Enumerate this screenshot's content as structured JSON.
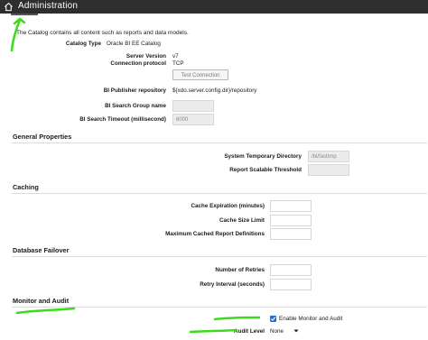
{
  "header": {
    "title": "Administration",
    "home_icon": "home-icon"
  },
  "catalog": {
    "description": "The Catalog contains all content such as reports and data models.",
    "type_label": "Catalog Type",
    "type_value": "Oracle BI EE Catalog",
    "server_version_label": "Server Version",
    "server_version_value": "v7",
    "connection_protocol_label": "Connection protocol",
    "connection_protocol_value": "TCP",
    "test_connection_label": "Test Connection",
    "bi_publisher_repository_label": "BI Publisher repository",
    "bi_publisher_repository_value": "${xdo.server.config.dir}/repository",
    "bi_search_group_label": "BI Search Group name",
    "bi_search_group_value": "",
    "bi_search_timeout_label": "BI Search Timeout (millisecond)",
    "bi_search_timeout_value": "6000"
  },
  "general": {
    "title": "General Properties",
    "system_temp_dir_label": "System Temporary Directory",
    "system_temp_dir_value": "/bi/fasttmp",
    "report_scalable_threshold_label": "Report Scalable Threshold",
    "report_scalable_threshold_value": ""
  },
  "caching": {
    "title": "Caching",
    "cache_expiration_label": "Cache Expiration (minutes)",
    "cache_expiration_value": "",
    "cache_size_limit_label": "Cache Size Limit",
    "cache_size_limit_value": "",
    "max_cached_reports_label": "Maximum Cached Report Definitions",
    "max_cached_reports_value": ""
  },
  "failover": {
    "title": "Database Failover",
    "retries_label": "Number of Retries",
    "retries_value": "",
    "retry_interval_label": "Retry Interval (seconds)",
    "retry_interval_value": ""
  },
  "audit": {
    "title": "Monitor and Audit",
    "enable_label": "Enable Monitor and Audit",
    "enable_checked": true,
    "audit_level_label": "Audit Level",
    "audit_level_value": "None"
  },
  "annotation_color": "#3ddc1a"
}
